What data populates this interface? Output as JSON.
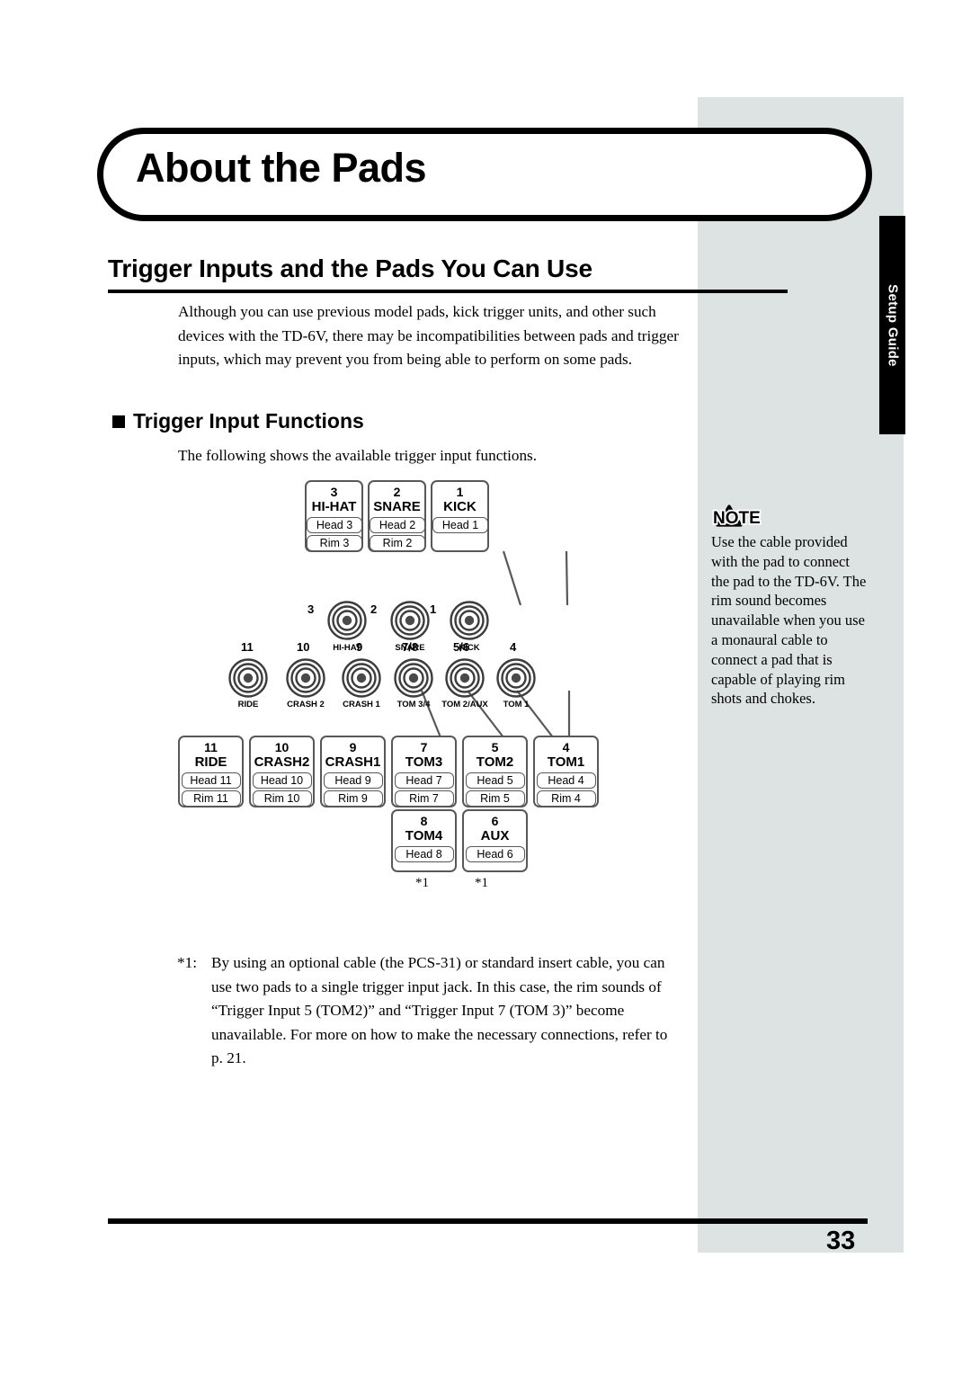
{
  "chapter": {
    "title": "About the Pads"
  },
  "section": {
    "heading": "Trigger Inputs and the Pads You Can Use"
  },
  "intro": {
    "paragraph": "Although you can use previous model pads, kick trigger units, and other such devices with the TD-6V, there may be incompatibilities between pads and trigger inputs, which may prevent you from being able to perform on some pads."
  },
  "subsection": {
    "heading": "Trigger Input Functions",
    "paragraph": "The following shows the available trigger input functions."
  },
  "note": {
    "label": "NOTE",
    "text": "Use the cable provided with the pad to connect the pad to the TD-6V. The rim sound becomes unavailable when you use a monaural cable to connect a pad that is capable of playing rim shots and chokes."
  },
  "footnote": {
    "marker": "*1:",
    "text": "By using an optional cable (the PCS-31) or standard insert cable, you can use two pads to a single trigger input jack. In this case, the rim sounds of “Trigger Input 5 (TOM2)” and “Trigger Input 7 (TOM 3)” become unavailable. For more on how to make the necessary connections, refer to p. 21."
  },
  "side_tab": {
    "label": "Setup Guide"
  },
  "footer": {
    "page_number": "33"
  },
  "diagram": {
    "top_pads": [
      {
        "num": "3",
        "name": "HI-HAT",
        "chips": [
          "Head 3",
          "Rim 3"
        ]
      },
      {
        "num": "2",
        "name": "SNARE",
        "chips": [
          "Head 2",
          "Rim 2"
        ]
      },
      {
        "num": "1",
        "name": "KICK",
        "chips": [
          "Head 1"
        ]
      }
    ],
    "top_jacks": [
      {
        "num": "3",
        "label": "HI-HAT"
      },
      {
        "num": "2",
        "label": "SNARE"
      },
      {
        "num": "1",
        "label": "KICK"
      }
    ],
    "bottom_jacks": [
      {
        "num": "11",
        "label": "RIDE"
      },
      {
        "num": "10",
        "label": "CRASH 2"
      },
      {
        "num": "9",
        "label": "CRASH 1"
      },
      {
        "num": "7/8",
        "label": "TOM 3/4"
      },
      {
        "num": "5/6",
        "label": "TOM 2/AUX"
      },
      {
        "num": "4",
        "label": "TOM 1"
      }
    ],
    "bottom_pads": [
      {
        "num": "11",
        "name": "RIDE",
        "chips": [
          "Head 11",
          "Rim 11"
        ]
      },
      {
        "num": "10",
        "name": "CRASH2",
        "chips": [
          "Head 10",
          "Rim 10"
        ]
      },
      {
        "num": "9",
        "name": "CRASH1",
        "chips": [
          "Head 9",
          "Rim 9"
        ]
      },
      {
        "num": "7",
        "name": "TOM3",
        "chips": [
          "Head 7",
          "Rim 7"
        ]
      },
      {
        "num": "5",
        "name": "TOM2",
        "chips": [
          "Head 5",
          "Rim 5"
        ]
      },
      {
        "num": "4",
        "name": "TOM1",
        "chips": [
          "Head 4",
          "Rim 4"
        ]
      }
    ],
    "extra_pads": [
      {
        "num": "8",
        "name": "TOM4",
        "chips": [
          "Head 8"
        ],
        "star": "*1"
      },
      {
        "num": "6",
        "name": "AUX",
        "chips": [
          "Head 6"
        ],
        "star": "*1"
      }
    ]
  }
}
